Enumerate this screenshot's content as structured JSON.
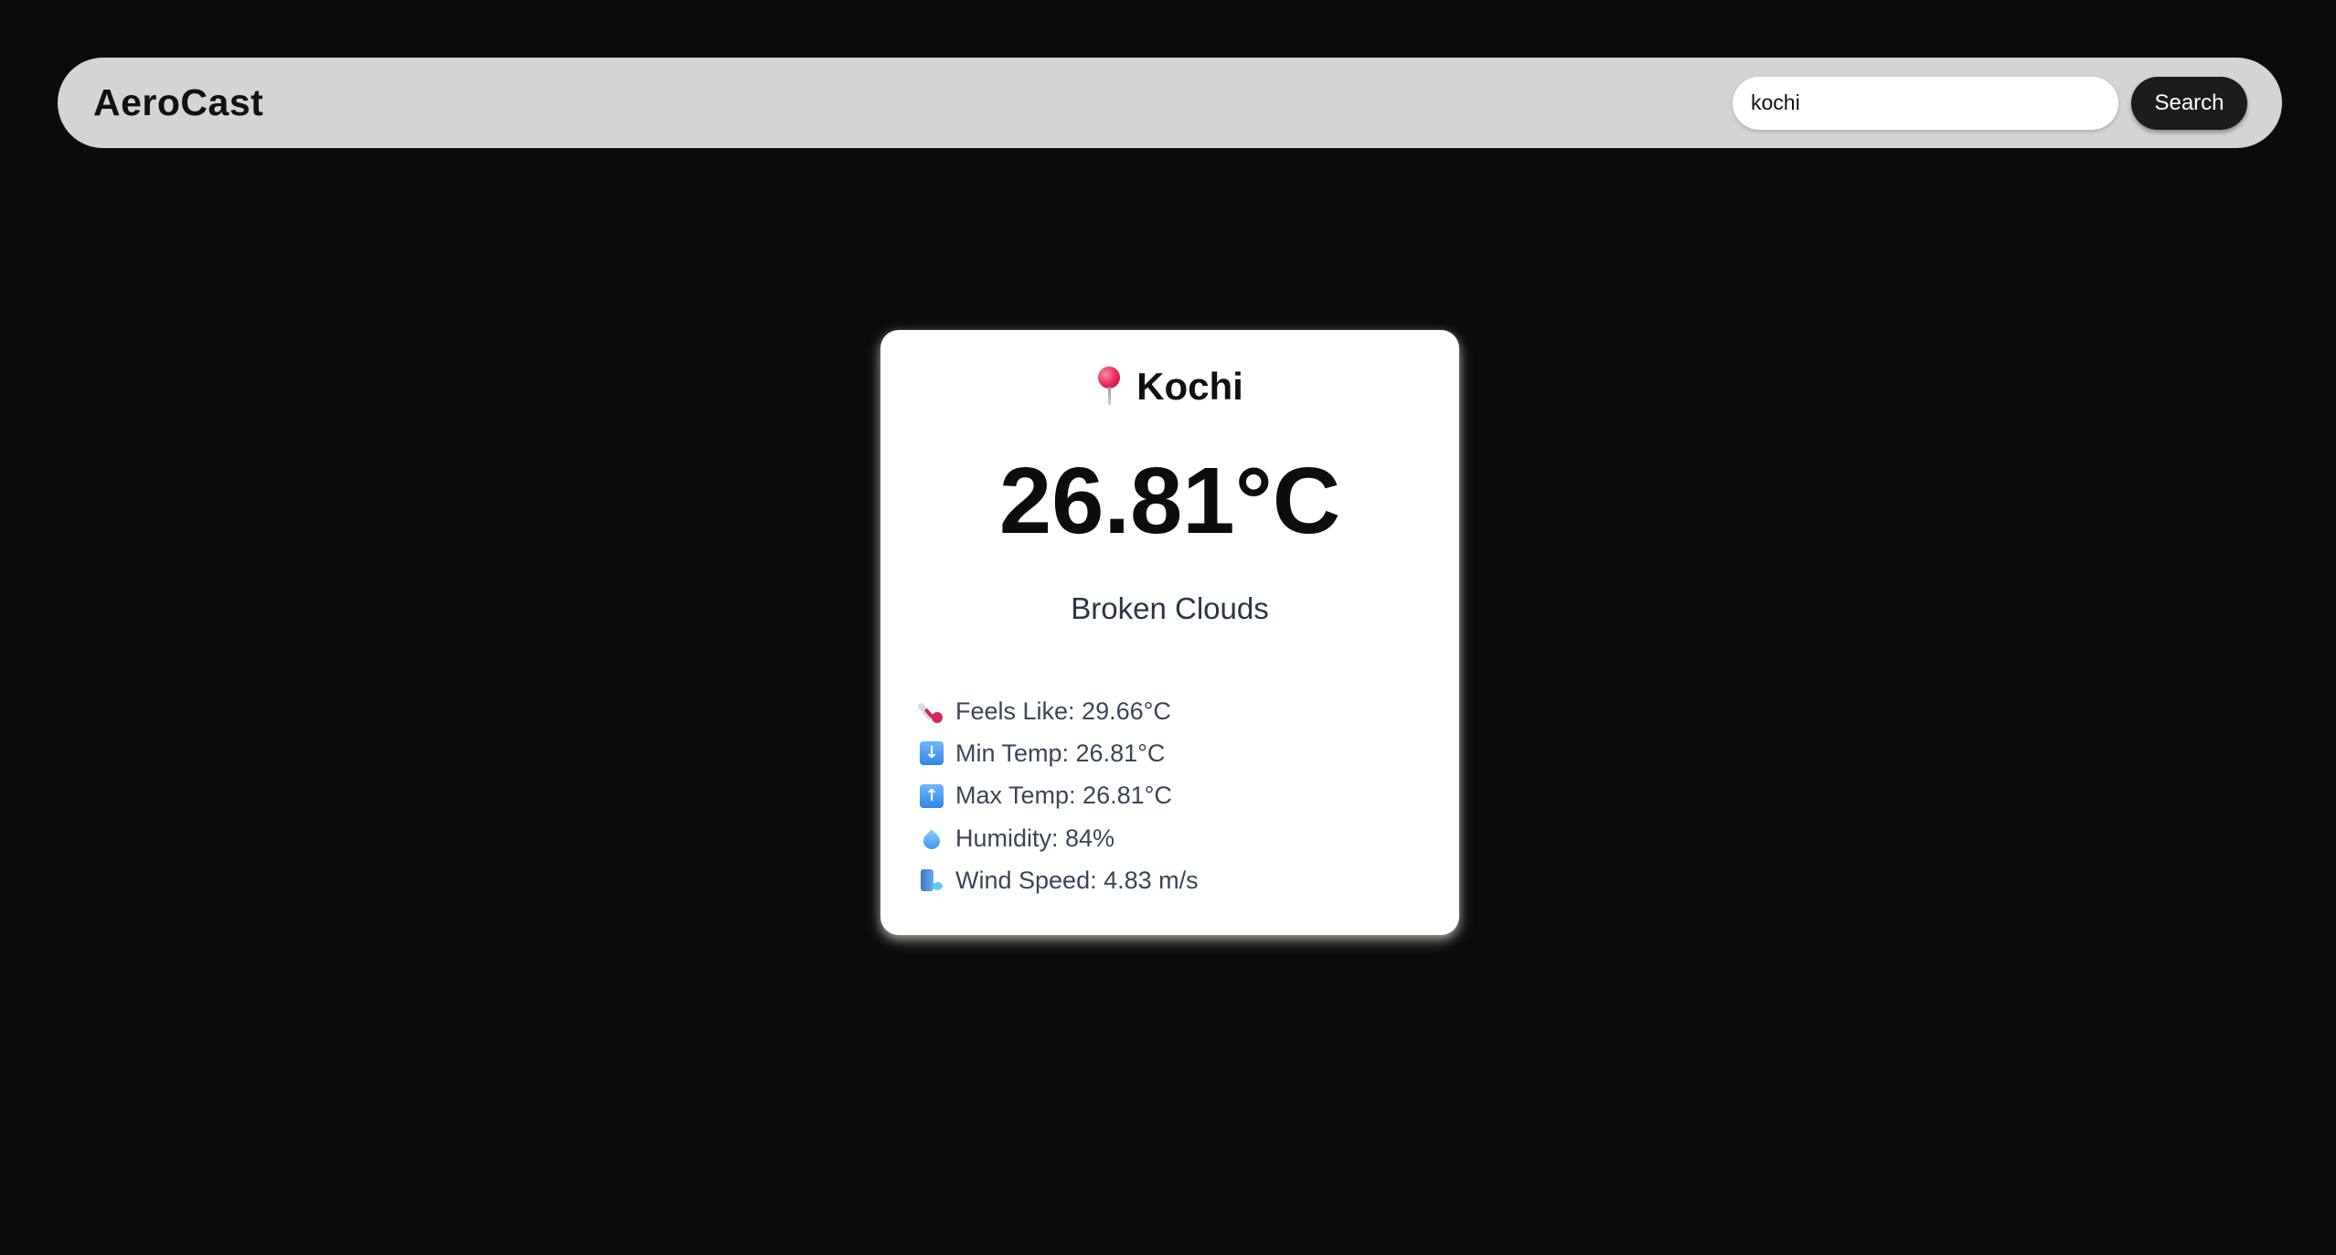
{
  "app": {
    "brand": "AeroCast"
  },
  "search": {
    "value": "kochi",
    "button_label": "Search"
  },
  "weather": {
    "city": "Kochi",
    "temperature": "26.81°C",
    "description": "Broken Clouds",
    "details": [
      {
        "icon": "thermometer-icon",
        "text": "Feels Like: 29.66°C"
      },
      {
        "icon": "down-arrow-icon",
        "text": "Min Temp: 26.81°C"
      },
      {
        "icon": "up-arrow-icon",
        "text": "Max Temp: 26.81°C"
      },
      {
        "icon": "droplet-icon",
        "text": "Humidity: 84%"
      },
      {
        "icon": "wind-icon",
        "text": "Wind Speed: 4.83 m/s"
      }
    ]
  },
  "colors": {
    "page_background": "#0b0b0b",
    "navbar_background": "#d4d4d4",
    "button_background": "#1c1c1c",
    "card_background": "#ffffff",
    "description_text": "#2b3648"
  }
}
